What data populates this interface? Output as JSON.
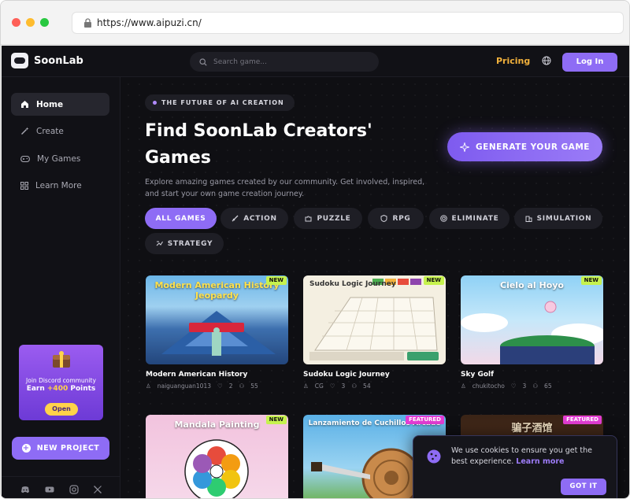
{
  "browser": {
    "url": "https://www.aipuzi.cn/"
  },
  "header": {
    "logo_text": "SoonLab",
    "search_placeholder": "Search game...",
    "pricing": "Pricing",
    "login": "Log In"
  },
  "sidebar": {
    "items": [
      {
        "label": "Home",
        "icon": "home-icon",
        "active": true
      },
      {
        "label": "Create",
        "icon": "wand-icon",
        "active": false
      },
      {
        "label": "My Games",
        "icon": "gamepad-icon",
        "active": false
      },
      {
        "label": "Learn More",
        "icon": "grid-icon",
        "active": false
      }
    ],
    "promo": {
      "line1": "Join Discord community",
      "line2_prefix": "Earn ",
      "points": "+400",
      "line2_suffix": " Points",
      "button": "Open"
    },
    "new_project": "NEW PROJECT"
  },
  "hero": {
    "tagline": "THE FUTURE OF AI CREATION",
    "title_line1": "Find SoonLab Creators'",
    "title_line2": "Games",
    "description": "Explore amazing games created by our community. Get involved, inspired, and start your own game creation journey.",
    "generate_button": "GENERATE YOUR GAME"
  },
  "filters": [
    {
      "label": "ALL GAMES",
      "active": true
    },
    {
      "label": "ACTION",
      "active": false
    },
    {
      "label": "PUZZLE",
      "active": false
    },
    {
      "label": "RPG",
      "active": false
    },
    {
      "label": "ELIMINATE",
      "active": false
    },
    {
      "label": "SIMULATION",
      "active": false
    },
    {
      "label": "STRATEGY",
      "active": false
    }
  ],
  "games": [
    {
      "name": "Modern American History",
      "author": "naiguanguan1013",
      "likes": "2",
      "plays": "55",
      "badge": "NEW",
      "thumb_title": "Modern American History Jeopardy"
    },
    {
      "name": "Sudoku Logic Journey",
      "author": "CG",
      "likes": "3",
      "plays": "54",
      "badge": "NEW",
      "thumb_title": "Sudoku Logic Journey"
    },
    {
      "name": "Sky Golf",
      "author": "chukitocho",
      "likes": "3",
      "plays": "65",
      "badge": "NEW",
      "thumb_title": "Cielo al Hoyo"
    },
    {
      "name": "",
      "author": "",
      "likes": "",
      "plays": "",
      "badge": "NEW",
      "thumb_title": "Mandala Painting"
    },
    {
      "name": "",
      "author": "",
      "likes": "",
      "plays": "",
      "badge": "FEATURED",
      "thumb_title": "Lanzamiento de Cuchillos Arcade"
    },
    {
      "name": "",
      "author": "",
      "likes": "",
      "plays": "",
      "badge": "FEATURED",
      "thumb_title": "骗子酒馆"
    }
  ],
  "cookie": {
    "text": "We use cookies to ensure you get the best experience.",
    "link": "Learn more",
    "button": "GOT IT"
  },
  "colors": {
    "accent": "#8e6cf5",
    "pricing": "#f2b13c",
    "background": "#0f0f13"
  }
}
